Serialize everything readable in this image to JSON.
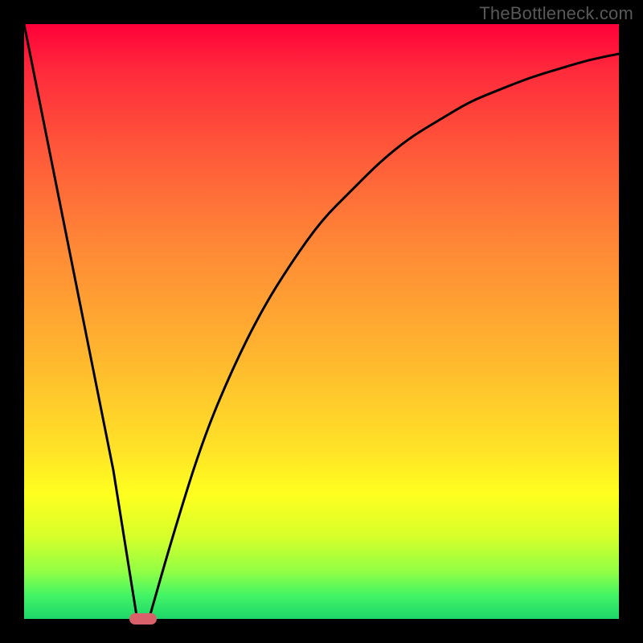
{
  "watermark": "TheBottleneck.com",
  "colors": {
    "curve": "#000000",
    "marker": "#d9626a",
    "background_black": "#000000"
  },
  "chart_data": {
    "type": "line",
    "title": "",
    "xlabel": "",
    "ylabel": "",
    "xlim": [
      0,
      100
    ],
    "ylim": [
      0,
      100
    ],
    "background_gradient": [
      "#ff003a",
      "#ffb42f",
      "#ffff1f",
      "#1dd66a"
    ],
    "marker": {
      "x": 20,
      "y": 0,
      "shape": "pill"
    },
    "series": [
      {
        "name": "left-descent",
        "x": [
          0,
          5,
          10,
          15,
          19
        ],
        "values": [
          100,
          75,
          50,
          25,
          0
        ]
      },
      {
        "name": "right-curve",
        "x": [
          21,
          25,
          30,
          35,
          40,
          45,
          50,
          55,
          60,
          65,
          70,
          75,
          80,
          85,
          90,
          95,
          100
        ],
        "values": [
          0,
          14,
          30,
          42,
          52,
          60,
          67,
          72,
          77,
          81,
          84,
          87,
          89,
          91,
          92.5,
          94,
          95
        ]
      }
    ]
  }
}
